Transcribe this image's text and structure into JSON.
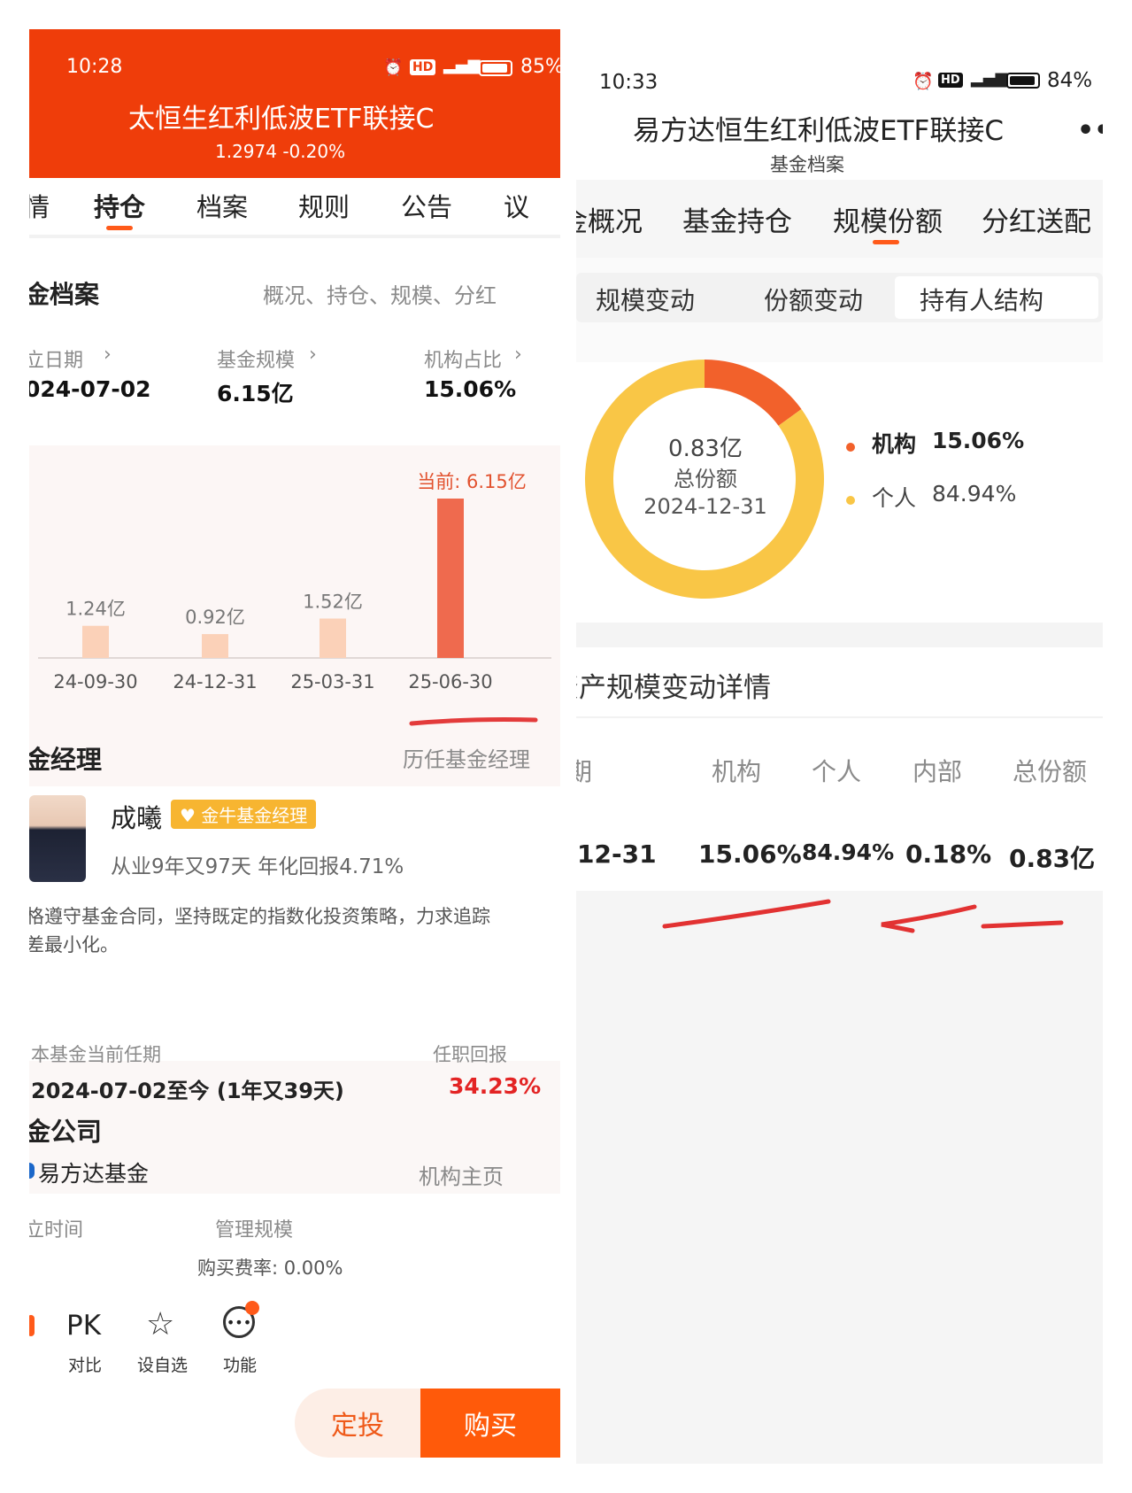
{
  "left": {
    "status": {
      "time": "10:28",
      "battery": "85%"
    },
    "header": {
      "title": "太恒生红利低波ETF联接C",
      "price_line": "1.2974 -0.20%"
    },
    "tabs": [
      "情",
      "持仓",
      "档案",
      "规则",
      "公告",
      "议"
    ],
    "active_tab": "持仓",
    "profile": {
      "title": "金档案",
      "links": "概况、持仓、规模、分红",
      "stats": [
        {
          "label": "立日期",
          "value": "024-07-02"
        },
        {
          "label": "基金规模",
          "value": "6.15亿"
        },
        {
          "label": "机构占比",
          "value": "15.06%"
        }
      ]
    },
    "chart_data": {
      "type": "bar",
      "categories": [
        "24-09-30",
        "24-12-31",
        "25-03-31",
        "25-06-30"
      ],
      "values": [
        1.24,
        0.92,
        1.52,
        6.15
      ],
      "value_labels": [
        "1.24亿",
        "0.92亿",
        "1.52亿",
        "当前: 6.15亿"
      ],
      "colors": [
        "#fbd1b8",
        "#fbd1b8",
        "#fbd1b8",
        "#ef6a4e"
      ],
      "ylim": [
        0,
        6.15
      ]
    },
    "manager": {
      "title": "金经理",
      "link": "历任基金经理",
      "name": "成曦",
      "badge": "金牛基金经理",
      "experience": "从业9年又97天 年化回报4.71%",
      "desc1": "格遵守基金合同，坚持既定的指数化投资策略，力求追踪",
      "desc2": "差最小化。",
      "term_label": "本基金当前任期",
      "term_value": "2024-07-02至今 (1年又39天)",
      "return_label": "任职回报",
      "return_value": "34.23%"
    },
    "company": {
      "title": "金公司",
      "name": "易方达基金",
      "link": "机构主页",
      "found_label": "立时间",
      "scale_label": "管理规模",
      "fee": "购买费率: 0.00%"
    },
    "bottom": {
      "pk": "PK",
      "compare": "对比",
      "watchlist": "设自选",
      "function": "功能",
      "fixed": "定投",
      "buy": "购买"
    }
  },
  "right": {
    "status": {
      "time": "10:33",
      "battery": "84%"
    },
    "header": {
      "title": "易方达恒生红利低波ETF联接C",
      "subtitle": "基金档案"
    },
    "tabs": [
      "金概况",
      "基金持仓",
      "规模份额",
      "分红送配"
    ],
    "active_tab": "规模份额",
    "segments": [
      "规模变动",
      "份额变动",
      "持有人结构"
    ],
    "active_segment": "持有人结构",
    "donut": {
      "center_value": "0.83亿",
      "center_label": "总份额",
      "center_date": "2024-12-31",
      "slices": [
        {
          "name": "机构",
          "value": 15.06,
          "label": "15.06%",
          "color": "#f2612b"
        },
        {
          "name": "个人",
          "value": 84.94,
          "label": "84.94%",
          "color": "#f9c646"
        }
      ]
    },
    "detail": {
      "title": "资产规模变动详情",
      "headers": [
        "期",
        "机构",
        "个人",
        "内部",
        "总份额"
      ],
      "rows": [
        [
          "12-31",
          "15.06%",
          "84.94%",
          "0.18%",
          "0.83亿"
        ]
      ]
    }
  }
}
